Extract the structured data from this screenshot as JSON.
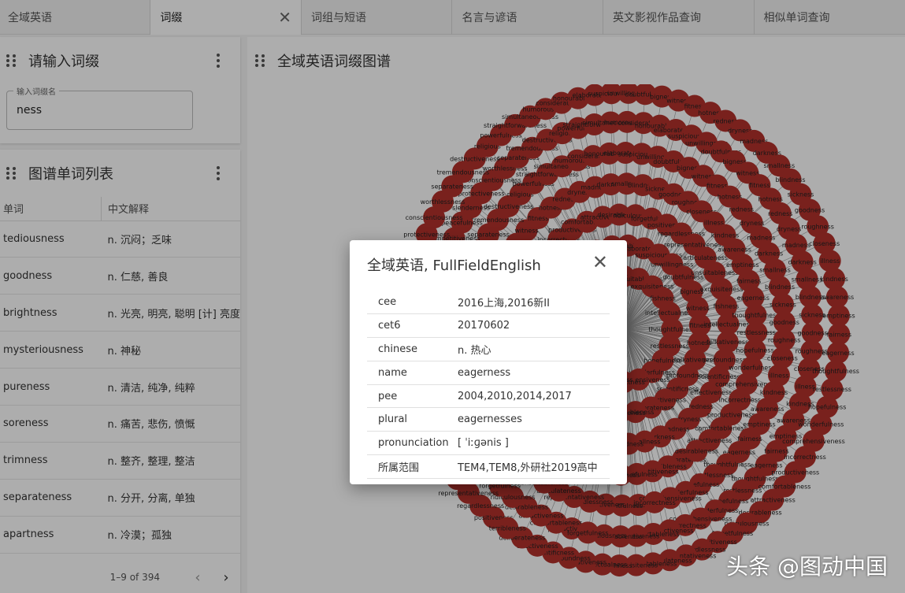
{
  "tabs": [
    {
      "label": "全域英语",
      "active": false
    },
    {
      "label": "词缀",
      "active": true
    },
    {
      "label": "词组与短语",
      "active": false
    },
    {
      "label": "名言与谚语",
      "active": false
    },
    {
      "label": "英文影视作品查询",
      "active": false
    },
    {
      "label": "相似单词查询",
      "active": false
    }
  ],
  "affix_panel": {
    "title": "请输入词缀",
    "field_label": "输入词缀名",
    "field_value": "ness"
  },
  "word_list_panel": {
    "title": "图谱单词列表",
    "columns": [
      "单词",
      "中文解释"
    ],
    "rows": [
      {
        "word": "tediousness",
        "meaning": "n. 沉闷；乏味"
      },
      {
        "word": "goodness",
        "meaning": "n. 仁慈, 善良"
      },
      {
        "word": "brightness",
        "meaning": "n. 光亮, 明亮, 聪明 [计] 亮度"
      },
      {
        "word": "mysteriousness",
        "meaning": "n. 神秘"
      },
      {
        "word": "pureness",
        "meaning": "n. 清洁, 纯净, 纯粹"
      },
      {
        "word": "soreness",
        "meaning": "n. 痛苦, 悲伤, 愤慨"
      },
      {
        "word": "trimness",
        "meaning": "n. 整齐, 整理, 整洁"
      },
      {
        "word": "separateness",
        "meaning": "n. 分开, 分离, 单独"
      },
      {
        "word": "apartness",
        "meaning": "n. 冷漠；孤独"
      }
    ],
    "pagination": "1–9 of 394"
  },
  "graph_panel": {
    "title": "全域英语词缀图谱",
    "node_color": "#b3322c",
    "node_labels": [
      "thoughtfulness",
      "restlessness",
      "hopefulness",
      "wonderfulness",
      "comprehensiveness",
      "incorrectness",
      "productiveness",
      "comfortableness",
      "attractiveness",
      "desirableness",
      "ridiculousness",
      "forgetfulness",
      "positiveness",
      "regardlessness",
      "representativeness",
      "articulateness",
      "unsuitableness",
      "exquisiteness",
      "fishness",
      "intellectualness",
      "talkativeness",
      "profoundness",
      "scientificness",
      "effectiveness",
      "deliberateness",
      "terribleness",
      "competitiveness",
      "peacefulness",
      "slenderness",
      "protectiveness",
      "conscientiousness",
      "worthlessness",
      "separateness",
      "tremendousness",
      "destructiveness",
      "religious",
      "powerfulness",
      "straightforwardness",
      "simultaneousness",
      "humorousness",
      "considerateness",
      "honourableness",
      "elaborateness",
      "suspiciousness",
      "unwillingness",
      "doubtfulness",
      "bigness",
      "witness",
      "fitness",
      "hotness",
      "redness",
      "dryness",
      "madness",
      "darkness",
      "smallness",
      "blindness",
      "sickness",
      "goodness",
      "roughness",
      "closeness",
      "illness",
      "kindness",
      "awareness",
      "emptiness",
      "fairness",
      "eagerness"
    ]
  },
  "dialog": {
    "title": "全域英语, FullFieldEnglish",
    "rows": [
      {
        "key": "cee",
        "value": "2016上海,2016新II"
      },
      {
        "key": "cet6",
        "value": "20170602"
      },
      {
        "key": "chinese",
        "value": "n. 热心"
      },
      {
        "key": "name",
        "value": "eagerness"
      },
      {
        "key": "pee",
        "value": "2004,2010,2014,2017"
      },
      {
        "key": "plural",
        "value": "eagernesses"
      },
      {
        "key": "pronunciation",
        "value": "[ ˈiːɡənis ]"
      },
      {
        "key": "所属范围",
        "value": "TEM4,TEM8,外研社2019高中"
      }
    ]
  },
  "watermark": "头条 @图动中国"
}
